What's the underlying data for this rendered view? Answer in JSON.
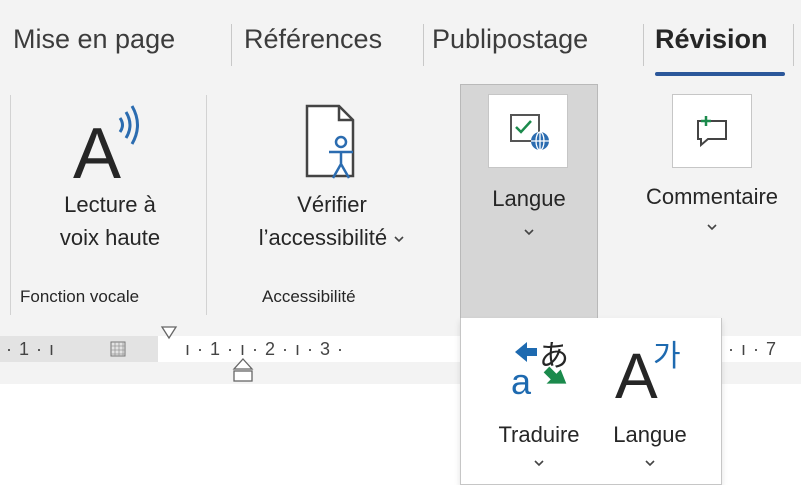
{
  "tabs": [
    {
      "label": "Mise en page",
      "active": false
    },
    {
      "label": "Références",
      "active": false
    },
    {
      "label": "Publipostage",
      "active": false
    },
    {
      "label": "Révision",
      "active": true
    }
  ],
  "ribbon": {
    "read_aloud": {
      "line1": "Lecture à",
      "line2": "voix haute",
      "icon": "read-aloud-icon"
    },
    "group_voice": "Fonction vocale",
    "accessibility": {
      "line1": "Vérifier",
      "line2": "l’accessibilité",
      "icon": "accessibility-checker-icon"
    },
    "group_accessibility": "Accessibilité",
    "language": {
      "label": "Langue",
      "icon": "language-icon"
    },
    "comment": {
      "label": "Commentaire",
      "icon": "new-comment-icon"
    }
  },
  "ruler": {
    "left_text": "· 1 · ı",
    "center_text": "ı · 1 · ı · 2 · ı · 3 ·",
    "right_text": "· ı · 7"
  },
  "dropdown": {
    "translate": {
      "label": "Traduire",
      "icon": "translate-icon"
    },
    "language": {
      "label": "Langue",
      "icon": "language-glyph-icon"
    }
  },
  "colors": {
    "accent": "#2b579a",
    "ribbon_bg": "#f3f3f3",
    "pressed_bg": "#d6d6d6",
    "translate_blue": "#1e6ab0",
    "translate_green": "#1b8a4c"
  }
}
